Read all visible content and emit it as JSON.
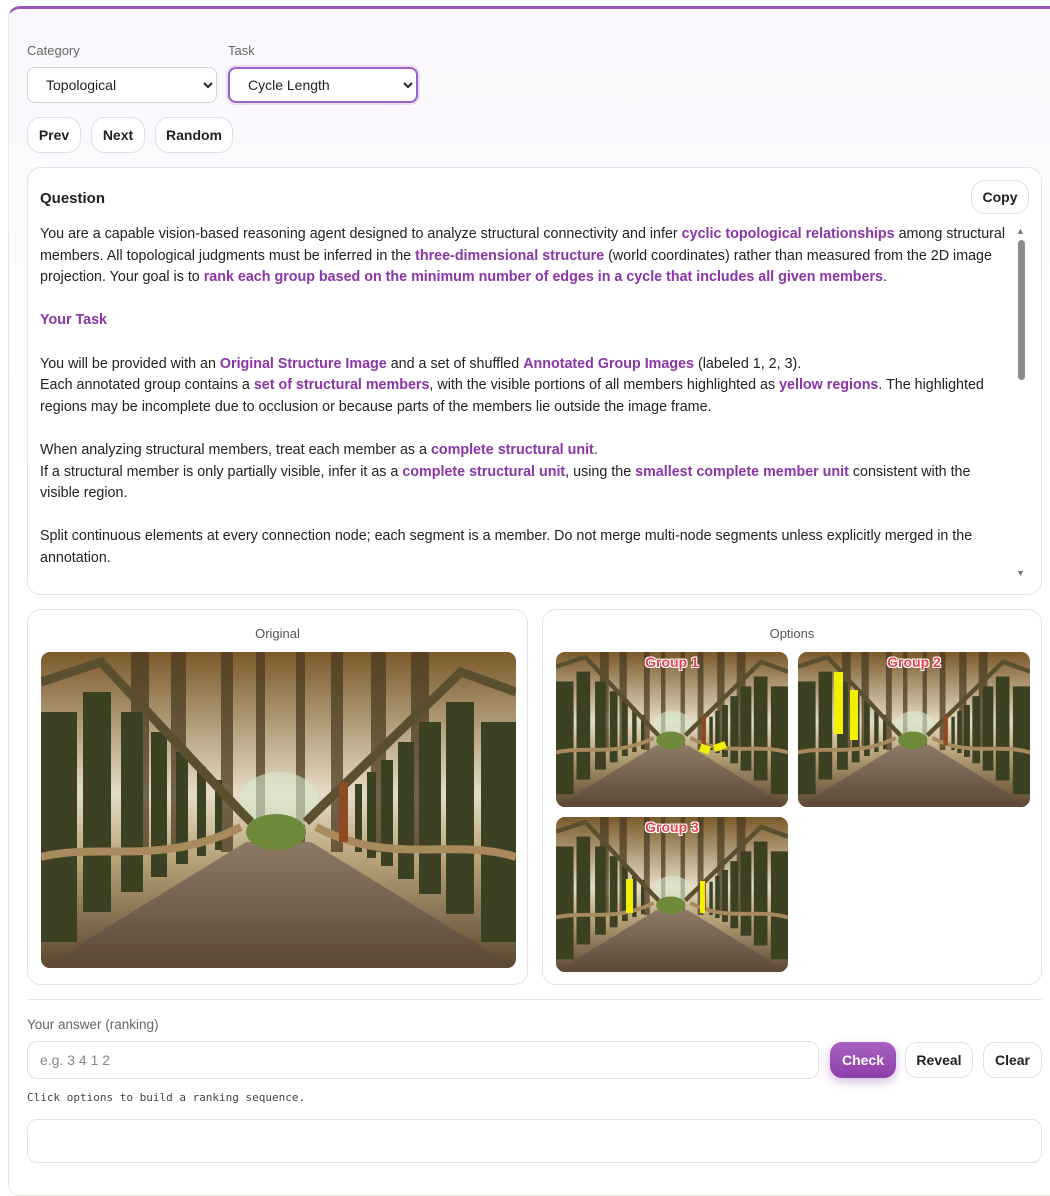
{
  "filters": {
    "category_label": "Category",
    "category_value": "Topological",
    "task_label": "Task",
    "task_value": "Cycle Length"
  },
  "nav": {
    "prev": "Prev",
    "next": "Next",
    "random": "Random"
  },
  "question": {
    "title": "Question",
    "copy": "Copy",
    "paragraphs": [
      [
        {
          "t": "You are a capable vision-based reasoning agent designed to analyze structural connectivity and infer "
        },
        {
          "t": "cyclic topological relationships",
          "b": true
        },
        {
          "t": " among structural members. All topological judgments must be inferred in the "
        },
        {
          "t": "three-dimensional structure",
          "b": true
        },
        {
          "t": " (world coordinates) rather than measured from the 2D image projection. Your goal is to "
        },
        {
          "t": "rank each group based on the minimum number of edges in a cycle that includes all given members",
          "b": true
        },
        {
          "t": "."
        }
      ],
      [
        {
          "t": "Your Task",
          "b": true
        }
      ],
      [
        {
          "t": "You will be provided with an "
        },
        {
          "t": "Original Structure Image",
          "b": true
        },
        {
          "t": " and a set of shuffled "
        },
        {
          "t": "Annotated Group Images",
          "b": true
        },
        {
          "t": " (labeled 1, 2, 3)."
        },
        {
          "br": true
        },
        {
          "t": "Each annotated group contains a "
        },
        {
          "t": "set of structural members",
          "b": true
        },
        {
          "t": ", with the visible portions of all members highlighted as "
        },
        {
          "t": "yellow regions",
          "b": true
        },
        {
          "t": ". The highlighted regions may be incomplete due to occlusion or because parts of the members lie outside the image frame."
        }
      ],
      [
        {
          "t": "When analyzing structural members, treat each member as a "
        },
        {
          "t": "complete structural unit",
          "b": true
        },
        {
          "t": "."
        },
        {
          "br": true
        },
        {
          "t": "If a structural member is only partially visible, infer it as a "
        },
        {
          "t": "complete structural unit",
          "b": true
        },
        {
          "t": ", using the "
        },
        {
          "t": "smallest complete member unit",
          "b": true
        },
        {
          "t": " consistent with the visible region."
        }
      ],
      [
        {
          "t": "Split continuous elements at every connection node; each segment is a member. Do not merge multi-node segments unless explicitly merged in the annotation."
        }
      ]
    ]
  },
  "images": {
    "original_title": "Original",
    "options_title": "Options",
    "groups": [
      "Group 1",
      "Group 2",
      "Group 3"
    ]
  },
  "answer": {
    "label": "Your answer (ranking)",
    "placeholder": "e.g. 3 4 1 2",
    "value": "",
    "check": "Check",
    "reveal": "Reveal",
    "clear": "Clear",
    "hint": "Click options to build a ranking sequence.",
    "result": ""
  },
  "colors": {
    "accent": "#9b56b9",
    "highlight": "#f2f000",
    "group_label": "#e8434f"
  }
}
